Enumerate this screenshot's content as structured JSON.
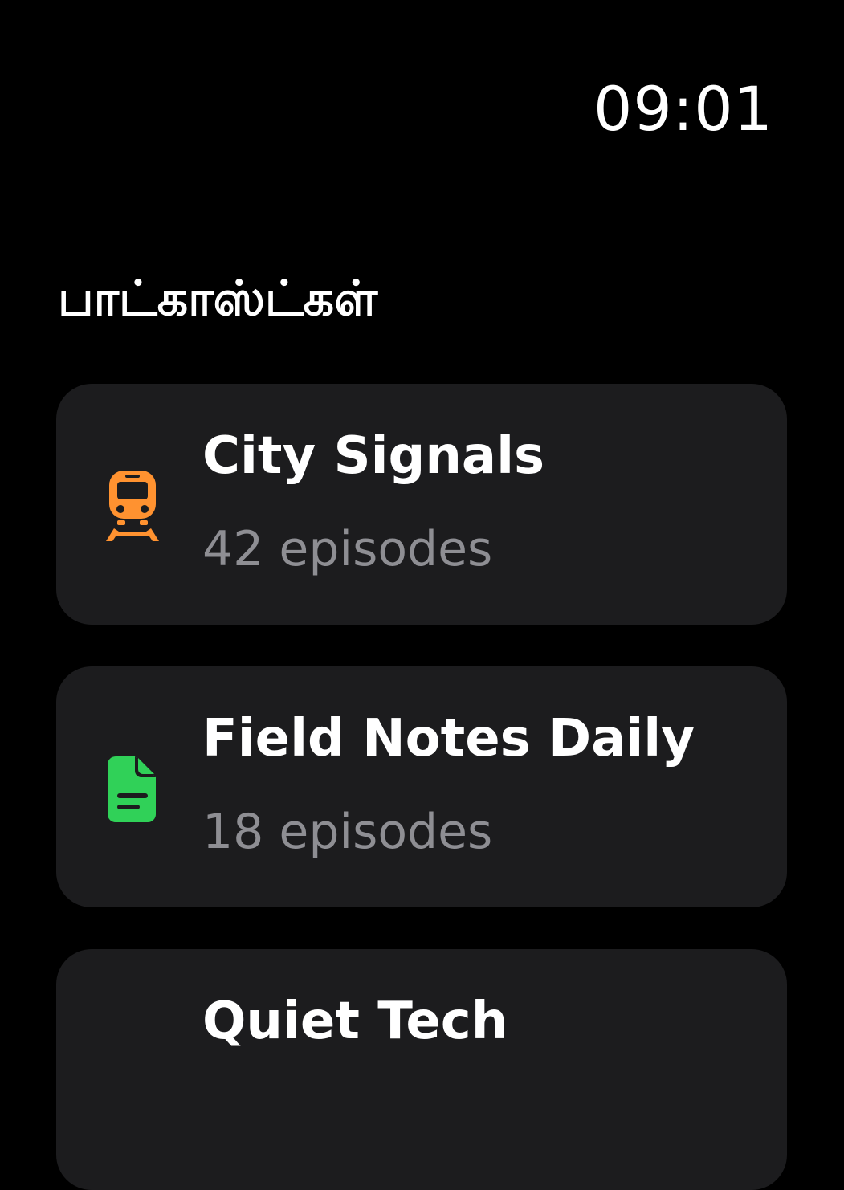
{
  "status": {
    "time": "09:01"
  },
  "header": {
    "title": "பாட்காஸ்ட்கள்"
  },
  "colors": {
    "background": "#000000",
    "card": "#1c1c1e",
    "secondary_text": "#8e8e93",
    "train_icon": "#ff9230",
    "doc_icon": "#30d158"
  },
  "podcasts": [
    {
      "title": "City Signals",
      "subtitle": "42 episodes",
      "icon": "tram-icon"
    },
    {
      "title": "Field Notes Daily",
      "subtitle": "18 episodes",
      "icon": "document-icon"
    },
    {
      "title": "Quiet Tech",
      "subtitle": "",
      "icon": ""
    }
  ]
}
